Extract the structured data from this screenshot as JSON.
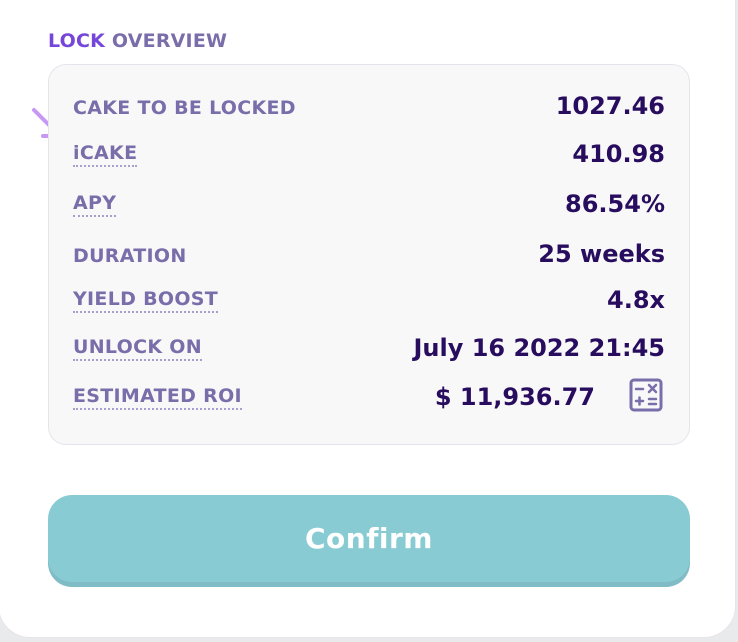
{
  "overview": {
    "title_accent": "LOCK",
    "title_rest": "OVERVIEW"
  },
  "rows": [
    {
      "label": "CAKE TO BE LOCKED",
      "value": "1027.46",
      "tooltip": false
    },
    {
      "label": "iCAKE",
      "value": "410.98",
      "tooltip": true
    },
    {
      "label": "APY",
      "value": "86.54%",
      "tooltip": true
    },
    {
      "label": "DURATION",
      "value": "25 weeks",
      "tooltip": false
    },
    {
      "label": "YIELD BOOST",
      "value": "4.8x",
      "tooltip": true
    },
    {
      "label": "UNLOCK ON",
      "value": "July 16 2022 21:45",
      "tooltip": true
    },
    {
      "label": "ESTIMATED ROI",
      "value": "$ 11,936.77",
      "tooltip": true
    }
  ],
  "icons": {
    "roi_calculator": "calculator-icon",
    "pointer": "arrow-pointer-icon"
  },
  "confirm_label": "Confirm",
  "colors": {
    "accent": "#7645d9",
    "label": "#7a6eaa",
    "value": "#280d5f",
    "confirm_bg": "#89cbd3",
    "arrow": "#c798f5"
  }
}
